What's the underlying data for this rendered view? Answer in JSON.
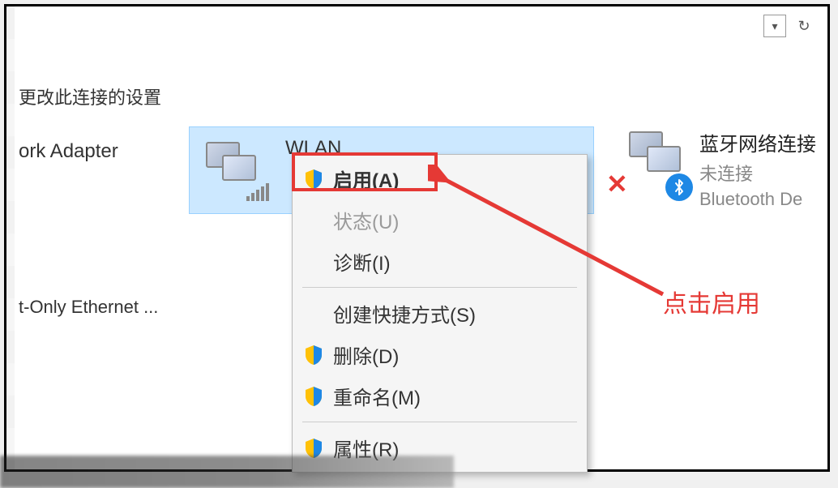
{
  "toolbar": {
    "dropdown_icon": "▾",
    "refresh_icon": "↻"
  },
  "header": {
    "settings_text": "更改此连接的设置"
  },
  "adapters": {
    "left_label": "ork Adapter",
    "ethernet_label": "t-Only Ethernet ...",
    "wlan": {
      "name": "WLAN"
    },
    "bluetooth": {
      "name": "蓝牙网络连接",
      "status": "未连接",
      "desc": "Bluetooth De"
    }
  },
  "context_menu": {
    "enable": "启用(A)",
    "status": "状态(U)",
    "diagnose": "诊断(I)",
    "create_shortcut": "创建快捷方式(S)",
    "delete": "删除(D)",
    "rename": "重命名(M)",
    "properties": "属性(R)"
  },
  "annotation": {
    "text": "点击启用"
  }
}
